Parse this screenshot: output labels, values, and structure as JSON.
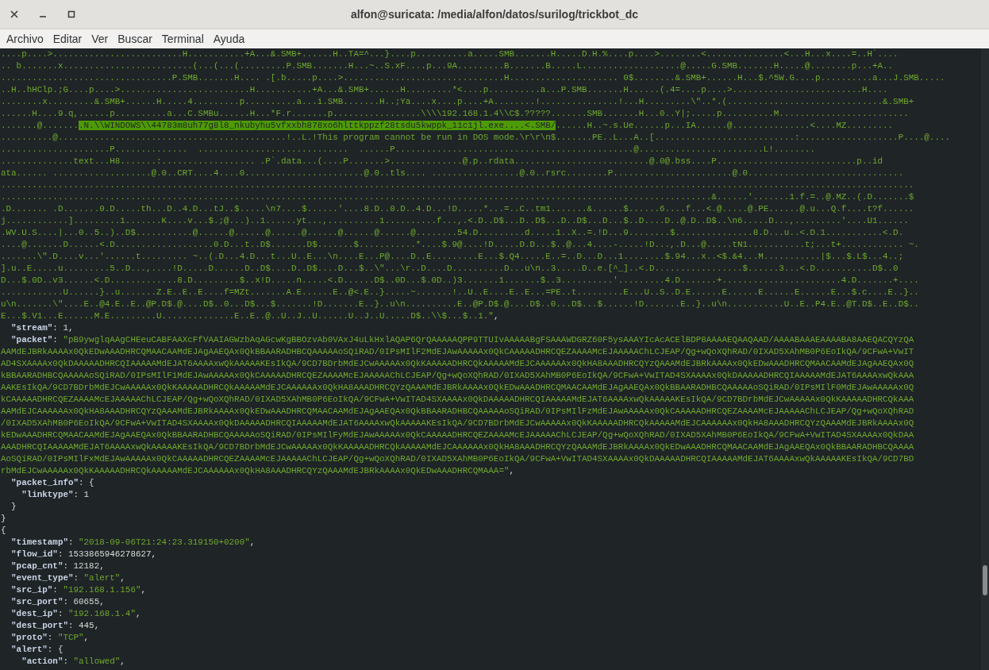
{
  "window": {
    "title": "alfon@suricata: /media/alfon/datos/surilog/trickbot_dc"
  },
  "menu": [
    "Archivo",
    "Editar",
    "Ver",
    "Buscar",
    "Terminal",
    "Ayuda"
  ],
  "terminal_lines": [
    [
      {
        "kind": "string",
        "text": "....p....>.........................H...........+A...&.SMB+......H..TA=^...}....p..........a.....SMB.......H.....D.H.%....p....>........<...............<...H...x....=..H`...."
      }
    ],
    [
      {
        "kind": "string",
        "text": ".. b.......x.........................(...(...(.........P.SMB.......H...~..S.xF....p...9A.........B.......B.....L...................@.....G.SMB.......H.....@........p...+A.."
      }
    ],
    [
      {
        "kind": "string",
        "text": ".................................P.SMB.......H.... .[.b.....p....>...............................H..................... 0$........&.SMB+......H...$.^5W.G....p..........a...J.SMB....."
      }
    ],
    [
      {
        "kind": "string",
        "text": "..H..hHClp.;G....p....>.........................H...........+A...&.SMB+......H.........*<....p..........a...P.SMB.......H......(.4=....p....>.........................H...."
      }
    ],
    [
      {
        "kind": "string",
        "text": "........x.........&.SMB+......H.....4.........p..........a...i.SMB.......H..;Ya....x....p....+A........!...............!...H.........\\\"..*.(..............................&.SMB+"
      }
    ],
    [
      {
        "kind": "string",
        "text": "......H....9.q,......p..........a...C.SMBu......H...*F.r.......p.................\\\\\\\\192.168.1.4\\\\C$.?????.......SMB.......H...0..Y|;.....p..........M........................."
      }
    ],
    [
      {
        "kind": "string",
        "text": ".......@......."
      },
      {
        "kind": "match",
        "text": ".N.\\\\WINDOWS\\\\44783m8uh77g8l8_nkubyhu5vfxxbh878xo6hlttkppzf28tsdu5kwppk_11c1jl.exe....<.SMB/"
      },
      {
        "kind": "string",
        "text": "......H..~.s.Ue......p...IA......@...............<....MZ........."
      }
    ],
    [
      {
        "kind": "string",
        "text": "..........@............................................!..L.!This program cannot be run in DOS mode.\\r\\r\\n$.......PE..L...A..[...........................:...................P....@...."
      }
    ],
    [
      {
        "kind": "string",
        "text": ".....................P..............  .............................  ......P..............................................@........................L!........"
      }
    ],
    [
      {
        "kind": "string",
        "text": "..............text...H8.......:.................. .P`.data...(....P.......>..............@.p..rdata..........................@.0@.bss....P...........................p..id"
      }
    ],
    [
      {
        "kind": "string",
        "text": "ata...... ...................@.0..CRT....4....0.......................@.0..tls.... .................@.0..rsrc........P.......................@.0.............................."
      }
    ],
    [
      {
        "kind": "string",
        "text": "................................................................................................................................................................................"
      }
    ],
    [
      {
        "kind": "string",
        "text": ".........................................................................................................................................&......'.......1.f.=..@.MZ..(.D.......$"
      }
    ],
    [
      {
        "kind": "string",
        "text": ".D....... .D.......0.D.....th...D..4.D...tJ..$.....\\n7....$......'....8.D..0.D..4.D...!D.....*...=..C..tm1.......&......$......6....f...<.@.....@.PE......@.u...Q.f....t?f......"
      }
    ],
    [
      {
        "kind": "string",
        "text": "j............].........1.......K....v...$.;@...)..1......yt...,..........1..........f...,.<.D..D$...D..D$...D..D$...D...$..D....D..@.D..D$..\\n6.....D...,.........'....U1......"
      }
    ],
    [
      {
        "kind": "string",
        "text": ".WV.U.S....|...0..5..)..D$...........@......@......@......@......@......@......@........54.D.........d.....1..X..=.!D...9........$...............8.D...u..<.D.1...........<.D."
      }
    ],
    [
      {
        "kind": "string",
        "text": "....@.......D......<.D...................0.D...t..D$.......D$.......$...........*....$.9@....!D.....D.D...$..@...4....-.....!D...,.D...@.....tN1...........t;...t+............ ~."
      }
    ],
    [
      {
        "kind": "string",
        "text": ".......\\\".D....v...'......t......... ~..(.D...4.D...t...U..E...\\n....E...P@....D..E.........E...$.Q4.....E..=..D...D...1........$.94...x..<$.&4...M...........|$...$.L$...4..;"
      }
    ],
    [
      {
        "kind": "string",
        "text": "].u..E.....u.........5..D...,....!D.....D......D..D$....D..D$....D...$..\\\"...\\r..D....D..........D...u\\n..3.....D..e.[^_]..<.D.................$......3...<.D...........D$..0"
      }
    ],
    [
      {
        "kind": "string",
        "text": "D...$.0D..v3......<.D.............8.D.........$..x!D.....n.....<.D......D$..0D...$.0D..)3.......1.......$..3..........'.........4.D.......+.......................4.D.......+...."
      }
    ],
    [
      {
        "kind": "string",
        "text": "............U......}..u.......Z.E..E..E....f=MZt.......A.E......E..@<.E..}.....~.......!..U..E....E..E...=PE..t.........E...U..S..D.E......E......E......E......E...$.c....E..}.."
      }
    ],
    [
      {
        "kind": "string",
        "text": "u\\n.......\\\"....E..@4.E..E..@P.D$.@....D$..0...D$...$.......!D.......E..}..u\\n..........E..@P.D$.@....D$..0...D$...$......!D.......E..}..u\\n...........U..E..P4.E..@T.D$..E..D$.."
      }
    ],
    [
      {
        "kind": "string",
        "text": "E...$.V1...E......M.E.........U..............E..E..@..U..J..U......U..J..U.....D$..\\\\$...$..1.\""
      },
      {
        "kind": "punct",
        "text": ","
      }
    ],
    [
      {
        "kind": "key",
        "text": "  \"stream\""
      },
      {
        "kind": "punct",
        "text": ": "
      },
      {
        "kind": "number",
        "text": "1"
      },
      {
        "kind": "punct",
        "text": ","
      }
    ],
    [
      {
        "kind": "key",
        "text": "  \"packet\""
      },
      {
        "kind": "punct",
        "text": ": "
      },
      {
        "kind": "string",
        "text": "\"pB9ywglqAAgCHEeuCABFAAXcFfVAAIAGWzbAqAGcwKgBBOzvAb0VAxJ4uLkHxlAQAP6QrQAAAAAQPP9TTUIvAAAAABgFSAAAWDGRZ60F5ysAAAYIcAcACElBDP8AAAAEQAAQAAD/AAAABAAAEAAAABA8AAEQACQYzQA"
      }
    ],
    [
      {
        "kind": "string",
        "text": "AAMdEJBRkAAAAx0QkEDwAAADHRCQMAACAAMdEJAgAAEQAx0QkBBAARADHBCQAAAAAoSQiRAD/0IPsMIlF2MdEJAwAAAAAx0QkCAAAAADHRCQEZAAAAMcEJAAAAAChLCJEAP/Qg+wQoXQhRAD/0IXAD5XAhMB0P6EoIkQA/9CFwA+VwIT"
      }
    ],
    [
      {
        "kind": "string",
        "text": "AD4SXAAAAx0QkDAAAAADHRCQIAAAAAMdEJAT6AAAAxwQkAAAAAKEsIkQA/9CD7BDrbMdEJCwAAAAAx0QkKAAAAADHRCQkAAAAAMdEJCAAAAAAx0QkHA8AAADHRCQYzQAAAMdEJBRkAAAAx0QkEDwAAADHRCQMAACAAMdEJAgAAEQAx0Q"
      }
    ],
    [
      {
        "kind": "string",
        "text": "kBBAARADHBCQAAAAAoSQiRAD/0IPsMIlF1MdEJAwAAAAAx0QkCAAAAADHRCQEZAAAAMcEJAAAAAChLCJEAP/Qg+wQoXQhRAD/0IXAD5XAhMB0P6EoIkQA/9CFwA+VwITAD4SXAAAAx0QkDAAAAADHRCQIAAAAAMdEJAT6AAAAxwQkAAA"
      }
    ],
    [
      {
        "kind": "string",
        "text": "AAKEsIkQA/9CD7BDrbMdEJCwAAAAAx0QkKAAAAADHRCQkAAAAAMdEJCAAAAAAx0QkHA8AAADHRCQYzQAAAMdEJBRkAAAAx0QkEDwAAADHRCQMAACAAMdEJAgAAEQAx0QkBBAARADHBCQAAAAAoSQiRAD/0IPsMIlF0MdEJAwAAAAAx0Q"
      }
    ],
    [
      {
        "kind": "string",
        "text": "kCAAAAADHRCQEZAAAAMcEJAAAAAChLCJEAP/Qg+wQoXQhRAD/0IXAD5XAhMB0P6EoIkQA/9CFwA+VwITAD4SXAAAAx0QkDAAAAADHRCQIAAAAAMdEJAT6AAAAxwQkAAAAAKEsIkQA/9CD7BDrbMdEJCwAAAAAx0QkKAAAAADHRCQkAAA"
      }
    ],
    [
      {
        "kind": "string",
        "text": "AAMdEJCAAAAAAx0QkHA8AAADHRCQYzQAAAMdEJBRkAAAAx0QkEDwAAADHRCQMAACAAMdEJAgAAEQAx0QkBBAARADHBCQAAAAAoSQiRAD/0IPsMIlFzMdEJAwAAAAAx0QkCAAAAADHRCQEZAAAAMcEJAAAAAChLCJEAP/Qg+wQoXQhRAD"
      }
    ],
    [
      {
        "kind": "string",
        "text": "/0IXAD5XAhMB0P6EoIkQA/9CFwA+VwITAD4SXAAAAx0QkDAAAAADHRCQIAAAAAMdEJAT6AAAAxwQkAAAAAKEsIkQA/9CD7BDrbMdEJCwAAAAAx0QkKAAAAADHRCQkAAAAAMdEJCAAAAAAx0QkHA8AAADHRCQYzQAAAMdEJBRkAAAAx0Q"
      }
    ],
    [
      {
        "kind": "string",
        "text": "kEDwAAADHRCQMAACAAMdEJAgAAEQAx0QkBBAARADHBCQAAAAAoSQiRAD/0IPsMIlFyMdEJAwAAAAAx0QkCAAAAADHRCQEZAAAAMcEJAAAAAChLCJEAP/Qg+wQoXQhRAD/0IXAD5XAhMB0P6EoIkQA/9CFwA+VwITAD4SXAAAAx0QkDAA"
      }
    ],
    [
      {
        "kind": "string",
        "text": "AAADHRCQIAAAAAMdEJAT6AAAAxwQkAAAAAKEsIkQA/9CD7BDrbMdEJCwAAAAAx0QkKAAAAADHRCQkAAAAAMdEJCAAAAAAx0QkHA8AAADHRCQYzQAAAMdEJBRkAAAAx0QkEDwAAADHRCQMAACAAMdEJAgAAEQAx0QkBBAARADHBCQAAAA"
      }
    ],
    [
      {
        "kind": "string",
        "text": "AoSQiRAD/0IPsMIlFxMdEJAwAAAAAx0QkCAAAAADHRCQEZAAAAMcEJAAAAAChLCJEAP/Qg+wQoXQhRAD/0IXAD5XAhMB0P6EoIkQA/9CFwA+VwITAD4SXAAAAx0QkDAAAAADHRCQIAAAAAMdEJAT6AAAAxwQkAAAAAKEsIkQA/9CD7BD"
      }
    ],
    [
      {
        "kind": "string",
        "text": "rbMdEJCwAAAAAx0QkKAAAAADHRCQkAAAAAMdEJCAAAAAAx0QkHA8AAADHRCQYzQAAAMdEJBRkAAAAx0QkEDwAAADHRCQMAAA=\""
      },
      {
        "kind": "punct",
        "text": ","
      }
    ],
    [
      {
        "kind": "key",
        "text": "  \"packet_info\""
      },
      {
        "kind": "punct",
        "text": ": {"
      }
    ],
    [
      {
        "kind": "key",
        "text": "    \"linktype\""
      },
      {
        "kind": "punct",
        "text": ": "
      },
      {
        "kind": "number",
        "text": "1"
      }
    ],
    [
      {
        "kind": "punct",
        "text": "  }"
      }
    ],
    [
      {
        "kind": "punct",
        "text": "}"
      }
    ],
    [
      {
        "kind": "punct",
        "text": "{"
      }
    ],
    [
      {
        "kind": "key",
        "text": "  \"timestamp\""
      },
      {
        "kind": "punct",
        "text": ": "
      },
      {
        "kind": "string",
        "text": "\"2018-09-06T21:24:23.319150+0200\""
      },
      {
        "kind": "punct",
        "text": ","
      }
    ],
    [
      {
        "kind": "key",
        "text": "  \"flow_id\""
      },
      {
        "kind": "punct",
        "text": ": "
      },
      {
        "kind": "number",
        "text": "1533865946278627"
      },
      {
        "kind": "punct",
        "text": ","
      }
    ],
    [
      {
        "kind": "key",
        "text": "  \"pcap_cnt\""
      },
      {
        "kind": "punct",
        "text": ": "
      },
      {
        "kind": "number",
        "text": "12182"
      },
      {
        "kind": "punct",
        "text": ","
      }
    ],
    [
      {
        "kind": "key",
        "text": "  \"event_type\""
      },
      {
        "kind": "punct",
        "text": ": "
      },
      {
        "kind": "string",
        "text": "\"alert\""
      },
      {
        "kind": "punct",
        "text": ","
      }
    ],
    [
      {
        "kind": "key",
        "text": "  \"src_ip\""
      },
      {
        "kind": "punct",
        "text": ": "
      },
      {
        "kind": "string",
        "text": "\"192.168.1.156\""
      },
      {
        "kind": "punct",
        "text": ","
      }
    ],
    [
      {
        "kind": "key",
        "text": "  \"src_port\""
      },
      {
        "kind": "punct",
        "text": ": "
      },
      {
        "kind": "number",
        "text": "60655"
      },
      {
        "kind": "punct",
        "text": ","
      }
    ],
    [
      {
        "kind": "key",
        "text": "  \"dest_ip\""
      },
      {
        "kind": "punct",
        "text": ": "
      },
      {
        "kind": "string",
        "text": "\"192.168.1.4\""
      },
      {
        "kind": "punct",
        "text": ","
      }
    ],
    [
      {
        "kind": "key",
        "text": "  \"dest_port\""
      },
      {
        "kind": "punct",
        "text": ": "
      },
      {
        "kind": "number",
        "text": "445"
      },
      {
        "kind": "punct",
        "text": ","
      }
    ],
    [
      {
        "kind": "key",
        "text": "  \"proto\""
      },
      {
        "kind": "punct",
        "text": ": "
      },
      {
        "kind": "string",
        "text": "\"TCP\""
      },
      {
        "kind": "punct",
        "text": ","
      }
    ],
    [
      {
        "kind": "key",
        "text": "  \"alert\""
      },
      {
        "kind": "punct",
        "text": ": {"
      }
    ],
    [
      {
        "kind": "key",
        "text": "    \"action\""
      },
      {
        "kind": "punct",
        "text": ": "
      },
      {
        "kind": "string",
        "text": "\"allowed\""
      },
      {
        "kind": "punct",
        "text": ","
      }
    ]
  ]
}
